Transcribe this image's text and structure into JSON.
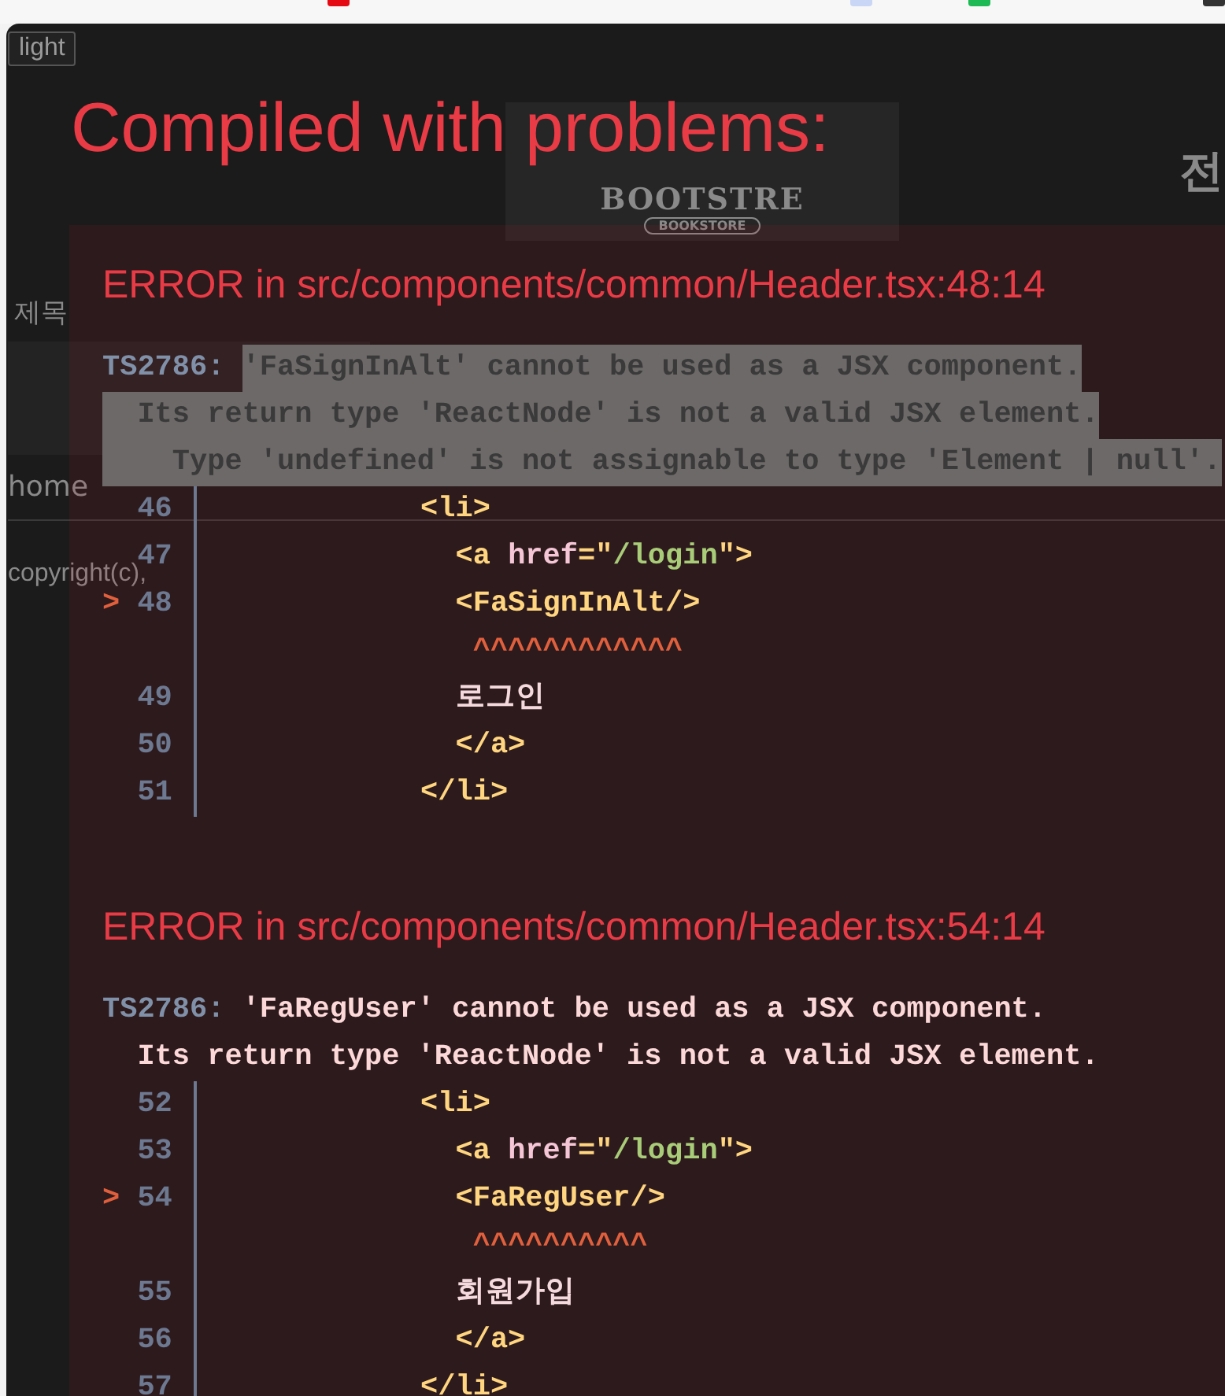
{
  "browser_strip": {
    "icons": [
      {
        "color": "#e50914"
      },
      {
        "color": "#c9d6f5"
      },
      {
        "color": "#1db954"
      },
      {
        "color": "#333333"
      }
    ]
  },
  "page": {
    "theme_button": "light",
    "logo": {
      "title": "BOOTSTRE",
      "subtitle": "BOOKSTORE"
    },
    "heading": "전",
    "category": "제목",
    "body": "home",
    "footer": "copyright(c),"
  },
  "overlay": {
    "title": "Compiled with problems:",
    "errors": [
      {
        "heading": "ERROR in src/components/common/Header.tsx:48:14",
        "code": "TS2786:",
        "highlighted": true,
        "message": [
          "'FaSignInAlt' cannot be used as a JSX component.",
          "  Its return type 'ReactNode' is not a valid JSX element.",
          "    Type 'undefined' is not assignable to type 'Element | null'."
        ],
        "lines": [
          {
            "number": "46",
            "tokens": [
              {
                "kind": "tag",
                "text": "           <li>"
              }
            ]
          },
          {
            "number": "47",
            "tokens": [
              {
                "kind": "tag",
                "text": "             <a "
              },
              {
                "kind": "attr",
                "text": "href"
              },
              {
                "kind": "tag",
                "text": "=\""
              },
              {
                "kind": "string",
                "text": "/login"
              },
              {
                "kind": "tag",
                "text": "\">"
              }
            ]
          },
          {
            "number": "48",
            "marker": ">",
            "tokens": [
              {
                "kind": "tag",
                "text": "             <FaSignInAlt/>"
              }
            ]
          },
          {
            "tokens": [
              {
                "kind": "caret",
                "text": "              ^^^^^^^^^^^^"
              }
            ]
          },
          {
            "number": "49",
            "tokens": [
              {
                "kind": "text",
                "text": "             로그인"
              }
            ]
          },
          {
            "number": "50",
            "tokens": [
              {
                "kind": "tag",
                "text": "             </a>"
              }
            ]
          },
          {
            "number": "51",
            "tokens": [
              {
                "kind": "tag",
                "text": "           </li>"
              }
            ]
          }
        ]
      },
      {
        "heading": "ERROR in src/components/common/Header.tsx:54:14",
        "code": "TS2786:",
        "highlighted": false,
        "message": [
          "'FaRegUser' cannot be used as a JSX component.",
          "  Its return type 'ReactNode' is not a valid JSX element."
        ],
        "lines": [
          {
            "number": "52",
            "tokens": [
              {
                "kind": "tag",
                "text": "           <li>"
              }
            ]
          },
          {
            "number": "53",
            "tokens": [
              {
                "kind": "tag",
                "text": "             <a "
              },
              {
                "kind": "attr",
                "text": "href"
              },
              {
                "kind": "tag",
                "text": "=\""
              },
              {
                "kind": "string",
                "text": "/login"
              },
              {
                "kind": "tag",
                "text": "\">"
              }
            ]
          },
          {
            "number": "54",
            "marker": ">",
            "tokens": [
              {
                "kind": "tag",
                "text": "             <FaRegUser/>"
              }
            ]
          },
          {
            "tokens": [
              {
                "kind": "caret",
                "text": "              ^^^^^^^^^^"
              }
            ]
          },
          {
            "number": "55",
            "tokens": [
              {
                "kind": "text",
                "text": "             회원가입"
              }
            ]
          },
          {
            "number": "56",
            "tokens": [
              {
                "kind": "tag",
                "text": "             </a>"
              }
            ]
          },
          {
            "number": "57",
            "tokens": [
              {
                "kind": "tag",
                "text": "           </li>"
              }
            ]
          }
        ]
      }
    ]
  }
}
